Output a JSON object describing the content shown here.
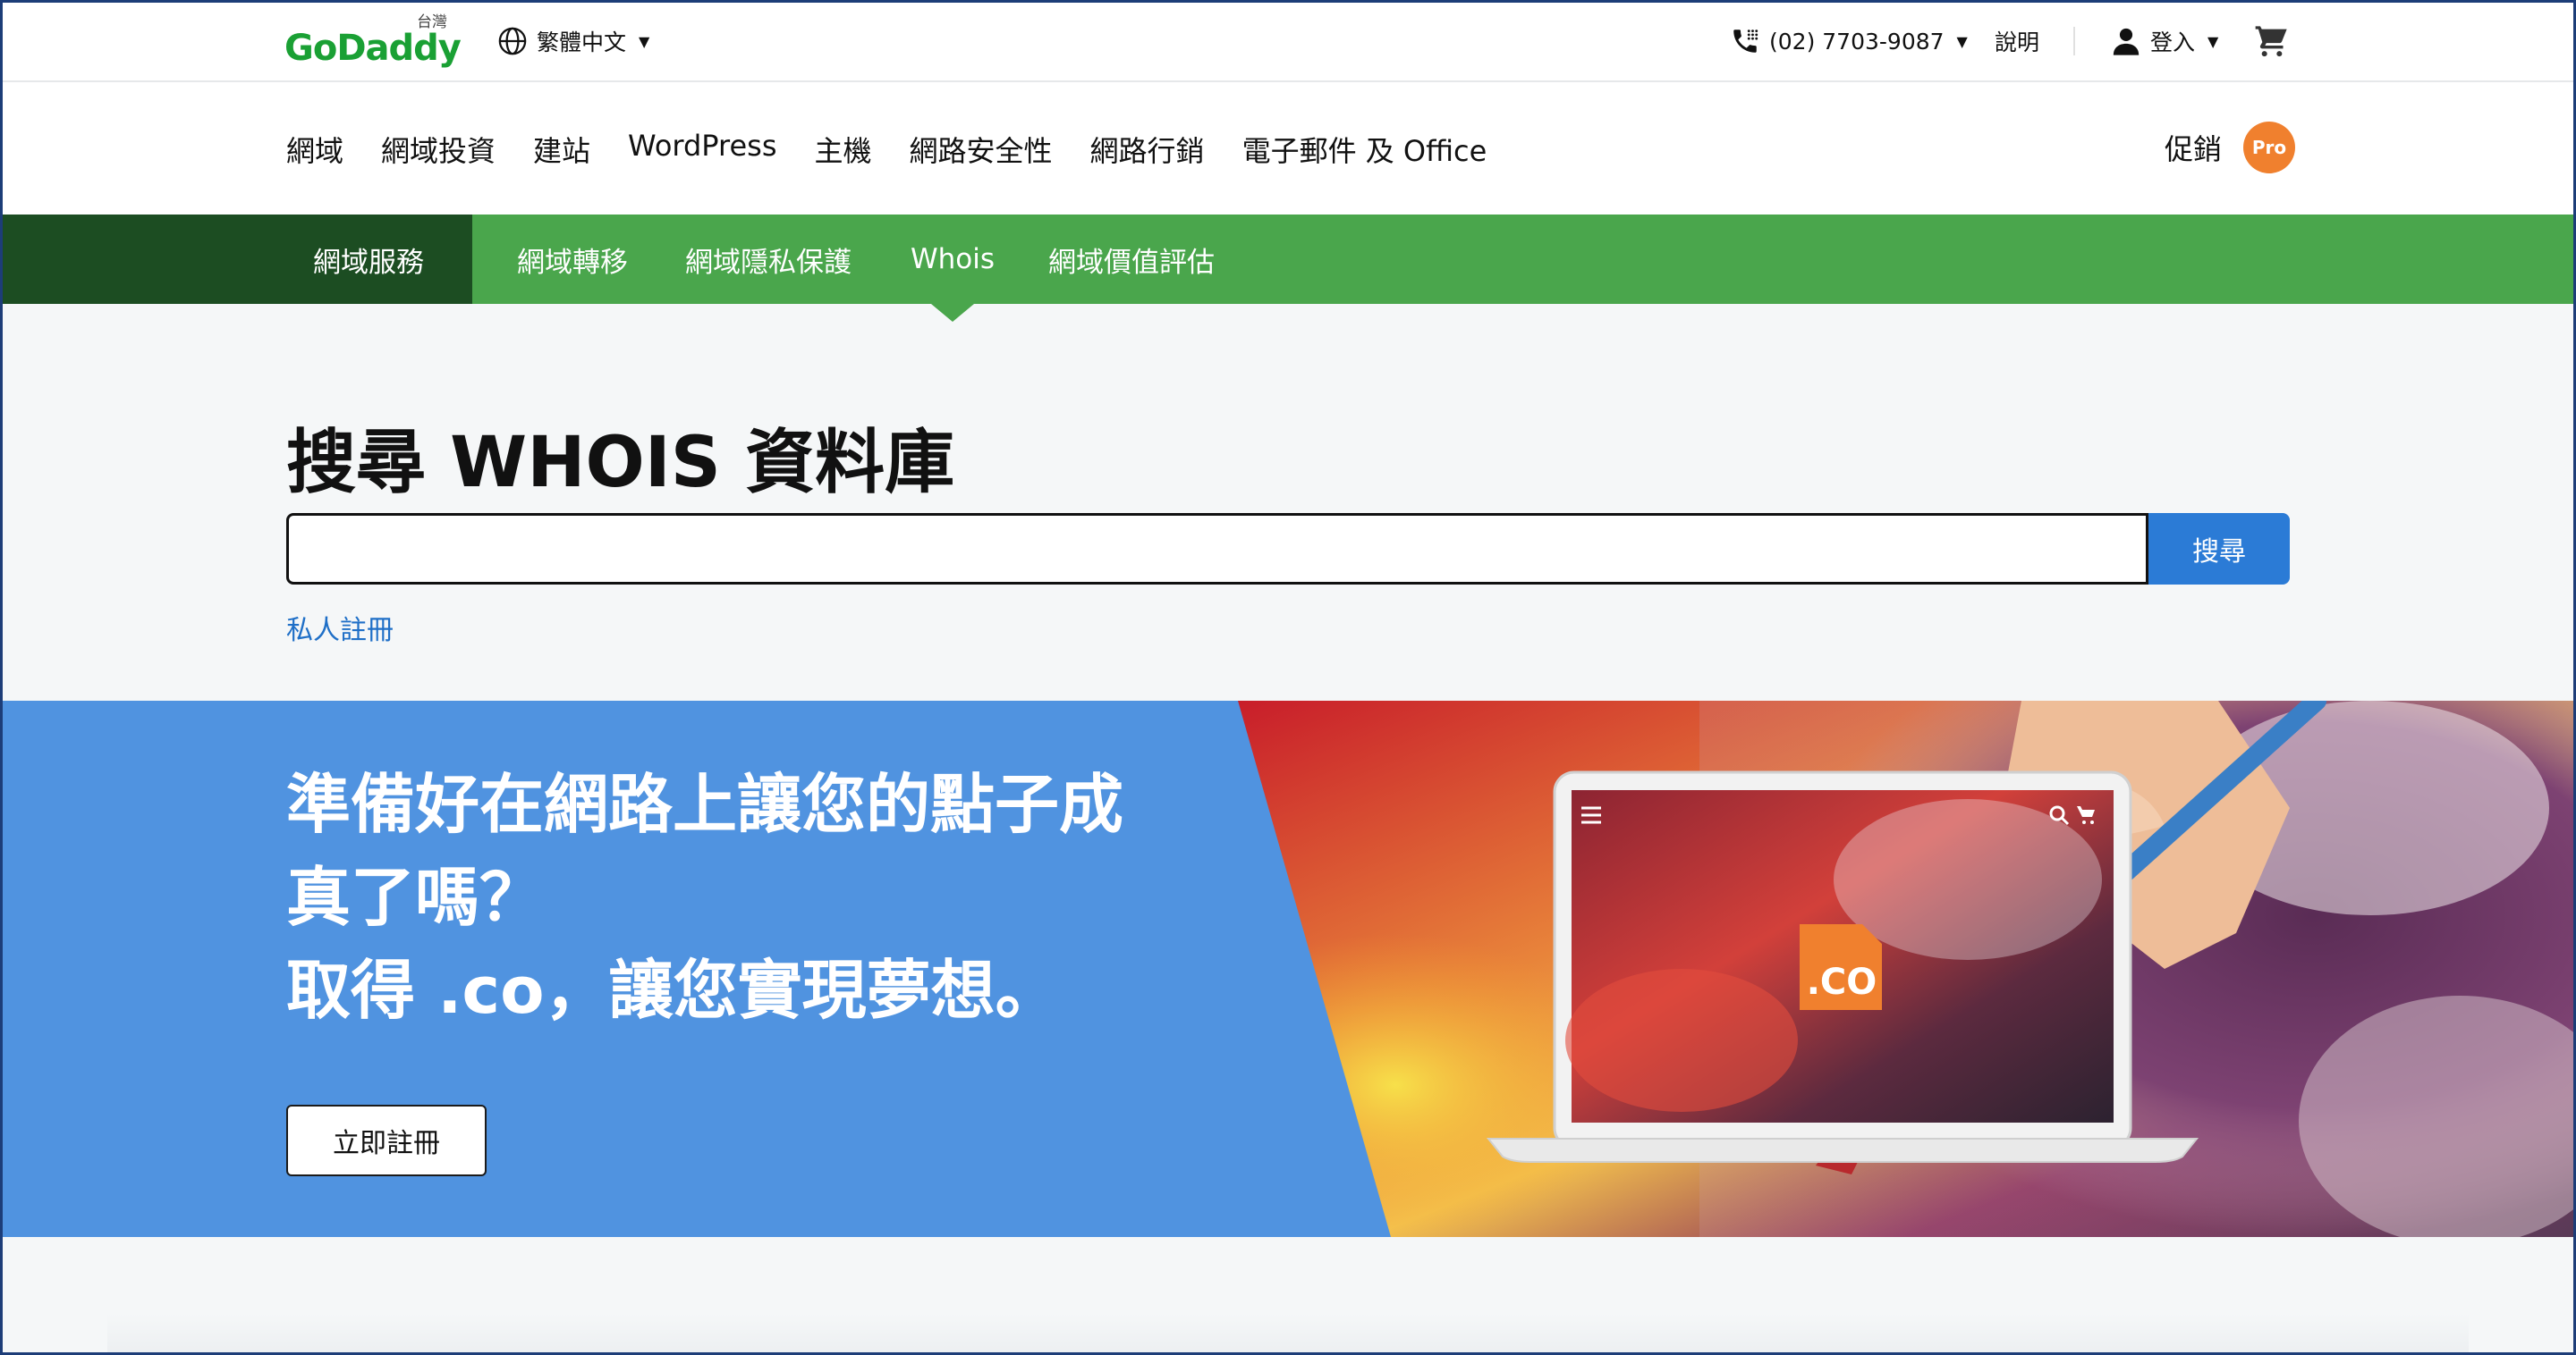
{
  "brand": {
    "logo_text": "GoDaddy",
    "region": "台灣",
    "accent": "#1aa034"
  },
  "util": {
    "language": "繁體中文",
    "phone": "(02) 7703-9087",
    "help": "說明",
    "signin": "登入"
  },
  "nav": {
    "items": [
      "網域",
      "網域投資",
      "建站",
      "WordPress",
      "主機",
      "網路安全性",
      "網路行銷",
      "電子郵件 及 Office"
    ],
    "promo": "促銷",
    "pro_badge": "Pro"
  },
  "subnav": {
    "items": [
      "網域服務",
      "網域轉移",
      "網域隱私保護",
      "Whois",
      "網域價值評估"
    ],
    "active": "網域服務",
    "current": "Whois"
  },
  "search": {
    "title": "搜尋 WHOIS 資料庫",
    "input_value": "",
    "button": "搜尋",
    "private_link": "私人註冊"
  },
  "banner": {
    "line1": "準備好在網路上讓您的點子成",
    "line2": "真了嗎？",
    "line3": "取得 .co，讓您實現夢想。",
    "cta": "立即註冊",
    "badge_text": ".CO",
    "bg_color": "#5093e0"
  }
}
